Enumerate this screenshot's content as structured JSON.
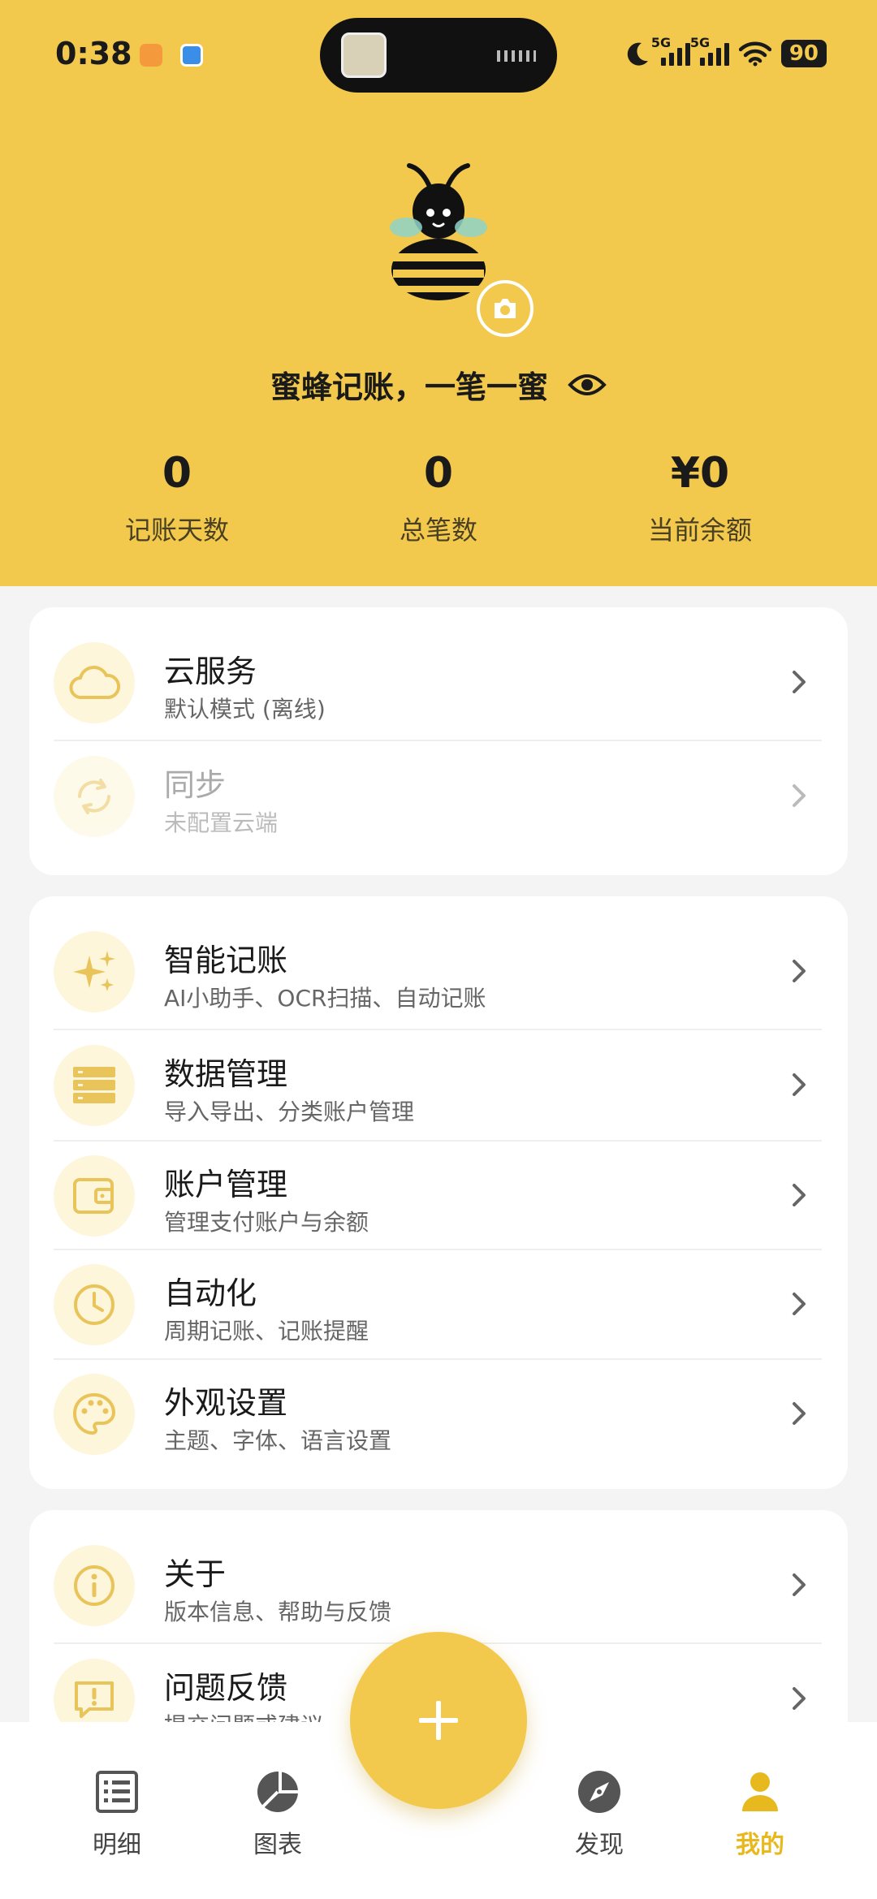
{
  "status_bar": {
    "time": "0:38",
    "battery": "90",
    "network_a": "5G",
    "network_b": "5G"
  },
  "profile": {
    "motto": "蜜蜂记账，一笔一蜜"
  },
  "stats": [
    {
      "value": "0",
      "label": "记账天数"
    },
    {
      "value": "0",
      "label": "总笔数"
    },
    {
      "value": "¥0",
      "label": "当前余额"
    }
  ],
  "cloud_card": {
    "items": [
      {
        "title": "云服务",
        "subtitle": "默认模式 (离线)",
        "icon": "cloud-icon",
        "enabled": true
      },
      {
        "title": "同步",
        "subtitle": "未配置云端",
        "icon": "sync-icon",
        "enabled": false
      }
    ]
  },
  "settings_card": {
    "items": [
      {
        "title": "智能记账",
        "subtitle": "AI小助手、OCR扫描、自动记账",
        "icon": "sparkle-icon"
      },
      {
        "title": "数据管理",
        "subtitle": "导入导出、分类账户管理",
        "icon": "database-icon"
      },
      {
        "title": "账户管理",
        "subtitle": "管理支付账户与余额",
        "icon": "wallet-icon"
      },
      {
        "title": "自动化",
        "subtitle": "周期记账、记账提醒",
        "icon": "clock-icon"
      },
      {
        "title": "外观设置",
        "subtitle": "主题、字体、语言设置",
        "icon": "palette-icon"
      }
    ]
  },
  "about_card": {
    "items": [
      {
        "title": "关于",
        "subtitle": "版本信息、帮助与反馈",
        "icon": "info-icon"
      },
      {
        "title": "问题反馈",
        "subtitle": "提交问题或建议",
        "icon": "feedback-icon"
      }
    ]
  },
  "bottom_nav": {
    "items": [
      {
        "label": "明细",
        "icon": "list-icon"
      },
      {
        "label": "图表",
        "icon": "pie-chart-icon"
      },
      {
        "label": "发现",
        "icon": "compass-icon"
      },
      {
        "label": "我的",
        "icon": "person-icon",
        "active": true
      }
    ],
    "fab_icon": "plus-icon"
  },
  "colors": {
    "accent": "#f2c94c",
    "icon_bg": "#fdf6da",
    "icon_fg": "#e8c45a",
    "active_nav": "#e8b91f"
  }
}
